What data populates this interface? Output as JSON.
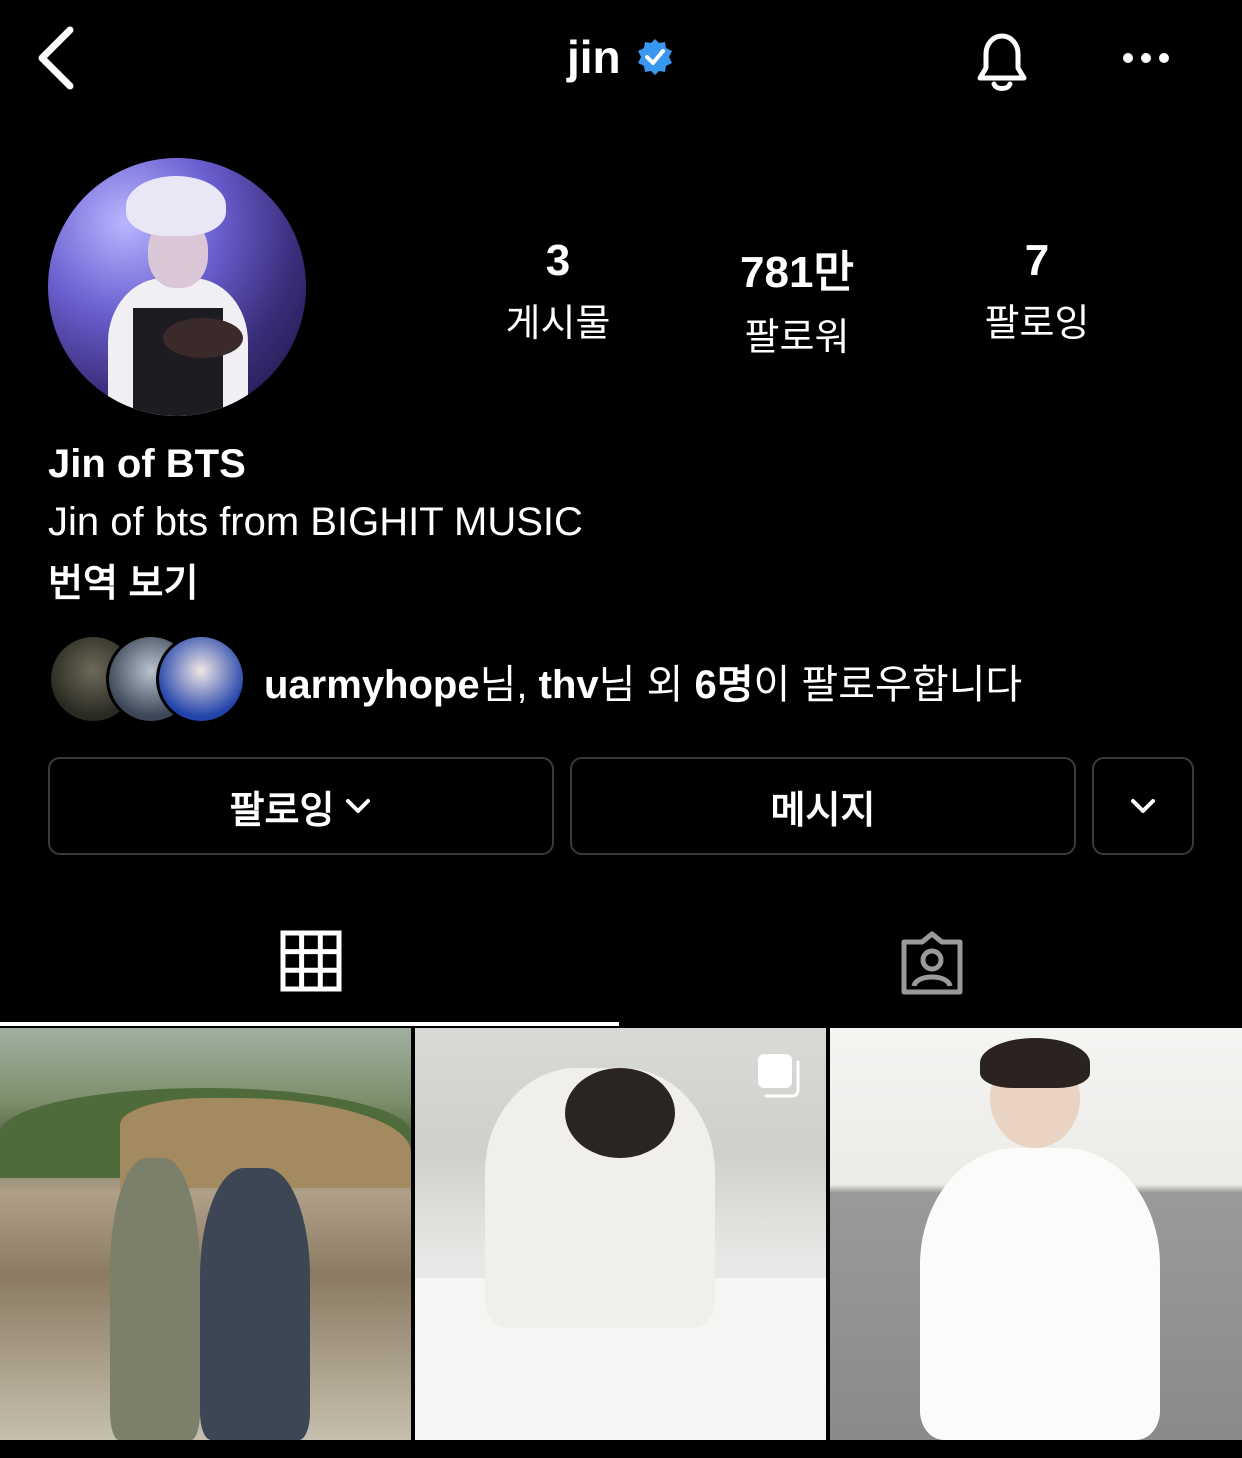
{
  "header": {
    "username": "jin",
    "verified_icon": "verified-badge-icon",
    "verified_color": "#3897f0"
  },
  "stats": [
    {
      "value": "3",
      "label": "게시물"
    },
    {
      "value": "781만",
      "label": "팔로워"
    },
    {
      "value": "7",
      "label": "팔로잉"
    }
  ],
  "profile": {
    "name": "Jin of BTS",
    "bio": "Jin of bts from BIGHIT MUSIC",
    "translate_label": "번역 보기"
  },
  "mutual": {
    "user1": "uarmyhope",
    "sep1": "님, ",
    "user2": "thv",
    "mid": "님 외 ",
    "count": "6명",
    "tail": "이 팔로우합니다"
  },
  "buttons": {
    "following_label": "팔로잉",
    "message_label": "메시지"
  },
  "tabs": {
    "active": "grid",
    "items": [
      "grid-icon",
      "tagged-icon"
    ]
  },
  "colors": {
    "background": "#000000",
    "button_border": "#3a3a3a",
    "verified": "#3897f0"
  }
}
